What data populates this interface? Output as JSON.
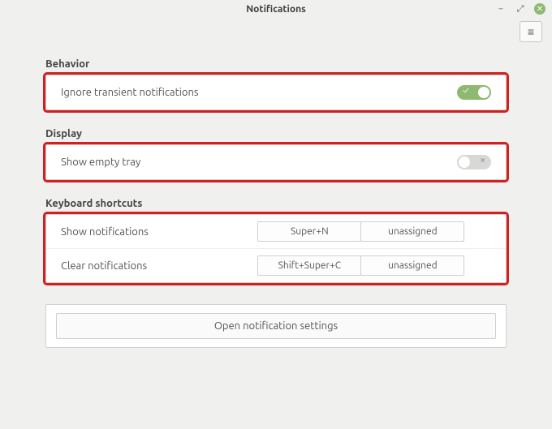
{
  "window": {
    "title": "Notifications"
  },
  "behavior": {
    "section_label": "Behavior",
    "ignore_transient": {
      "label": "Ignore transient notifications",
      "value": true
    }
  },
  "display": {
    "section_label": "Display",
    "show_empty_tray": {
      "label": "Show empty tray",
      "value": false
    }
  },
  "shortcuts": {
    "section_label": "Keyboard shortcuts",
    "rows": [
      {
        "label": "Show notifications",
        "shortcut1": "Super+N",
        "shortcut2": "unassigned"
      },
      {
        "label": "Clear notifications",
        "shortcut1": "Shift+Super+C",
        "shortcut2": "unassigned"
      }
    ]
  },
  "footer": {
    "open_settings": "Open notification settings"
  }
}
